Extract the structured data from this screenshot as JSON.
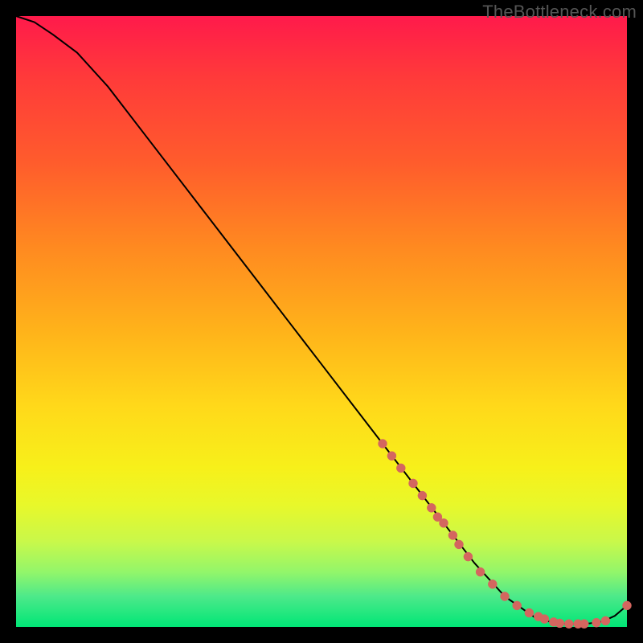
{
  "watermark": "TheBottleneck.com",
  "colors": {
    "background": "#000000",
    "curve": "#000000",
    "marker": "#d4665f",
    "gradient_top": "#ff1a4b",
    "gradient_bottom": "#00e676"
  },
  "chart_data": {
    "type": "line",
    "title": "",
    "xlabel": "",
    "ylabel": "",
    "xlim": [
      0,
      100
    ],
    "ylim": [
      0,
      100
    ],
    "series": [
      {
        "name": "bottleneck-curve",
        "x": [
          0,
          3,
          6,
          10,
          15,
          20,
          25,
          30,
          35,
          40,
          45,
          50,
          55,
          60,
          65,
          70,
          75,
          80,
          85,
          88,
          90,
          92,
          94,
          96,
          98,
          100
        ],
        "y": [
          100,
          99,
          97,
          94,
          88.5,
          82,
          75.5,
          69,
          62.5,
          56,
          49.5,
          43,
          36.5,
          30,
          23.5,
          17,
          10.5,
          5,
          1.5,
          0.7,
          0.5,
          0.5,
          0.6,
          0.9,
          1.8,
          3.5
        ]
      }
    ],
    "markers": {
      "name": "highlighted-points",
      "x": [
        60,
        61.5,
        63,
        65,
        66.5,
        68,
        69,
        70,
        71.5,
        72.5,
        74,
        76,
        78,
        80,
        82,
        84,
        85.5,
        86.5,
        88,
        89,
        90.5,
        92,
        93,
        95,
        96.5,
        100
      ],
      "y": [
        30,
        28,
        26,
        23.5,
        21.5,
        19.5,
        18,
        17,
        15,
        13.5,
        11.5,
        9,
        7,
        5,
        3.5,
        2.3,
        1.7,
        1.3,
        0.8,
        0.6,
        0.5,
        0.5,
        0.5,
        0.7,
        1.0,
        3.5
      ]
    }
  }
}
